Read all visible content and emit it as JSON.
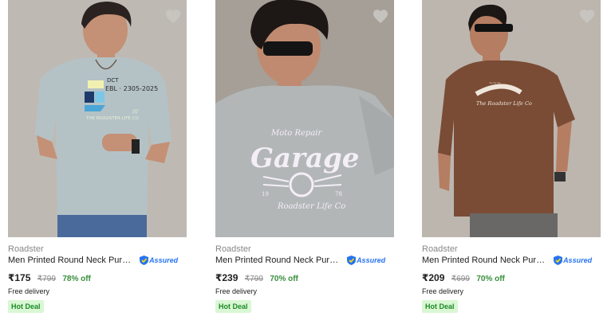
{
  "products": [
    {
      "brand": "Roadster",
      "title": "Men Printed Round Neck Pure C...",
      "assured": "Assured",
      "price": "₹175",
      "mrp": "₹799",
      "discount": "78% off",
      "delivery": "Free delivery",
      "deal": "Hot Deal",
      "image": {
        "bg": "#b8b4ad",
        "shirt": "#b4c2c6",
        "skin": "#c49076",
        "hair": "#2a2220",
        "print": "lines-logo"
      },
      "print_text": [
        "DCT",
        "EBL · 2305-2025",
        "THE ROADSTER LIFE CO"
      ]
    },
    {
      "brand": "Roadster",
      "title": "Men Printed Round Neck Pure C...",
      "assured": "Assured",
      "price": "₹239",
      "mrp": "₹799",
      "discount": "70% off",
      "delivery": "Free delivery",
      "deal": "Hot Deal",
      "image": {
        "bg": "#a59f97",
        "shirt": "#b2b6b7",
        "skin": "#c08a70",
        "hair": "#1d1715",
        "print": "garage"
      },
      "print_text": [
        "Moto Repair",
        "Garage",
        "Roadster Life Co"
      ]
    },
    {
      "brand": "Roadster",
      "title": "Men Printed Round Neck Pure C...",
      "assured": "Assured",
      "price": "₹209",
      "mrp": "₹699",
      "discount": "70% off",
      "delivery": "Free delivery",
      "deal": "Hot Deal",
      "image": {
        "bg": "#bcb6af",
        "shirt": "#7a4c35",
        "skin": "#b57d62",
        "hair": "#1c1614",
        "print": "arc-text"
      },
      "print_text": [
        "The Roadster Life Co"
      ]
    }
  ],
  "colors": {
    "price_off": "#388e3c",
    "assured_blue": "#2874f0",
    "deal_bg": "#d9f7d4",
    "deal_text": "#1b8a26"
  },
  "icons": [
    "wishlist-heart-icon",
    "assured-shield-icon"
  ]
}
